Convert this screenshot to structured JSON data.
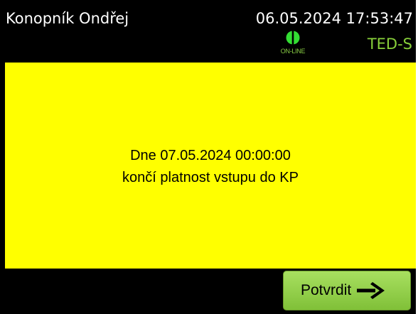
{
  "header": {
    "user_name": "Konopník Ondřej",
    "datetime": "06.05.2024 17:53:47",
    "online_label": "ON-LINE",
    "terminal_id": "TED-S"
  },
  "message": {
    "line1": "Dne 07.05.2024 00:00:00",
    "line2": "končí platnost vstupu do KP"
  },
  "footer": {
    "confirm_label": "Potvrdit",
    "confirm_icon": "arrow-right-icon"
  },
  "colors": {
    "background": "#000000",
    "message_panel": "#ffff00",
    "accent_green": "#88d03a",
    "button_bg_top": "#a8e060",
    "button_bg_bottom": "#80c038",
    "online_icon": "#33dd33",
    "online_label": "#88cc44"
  }
}
